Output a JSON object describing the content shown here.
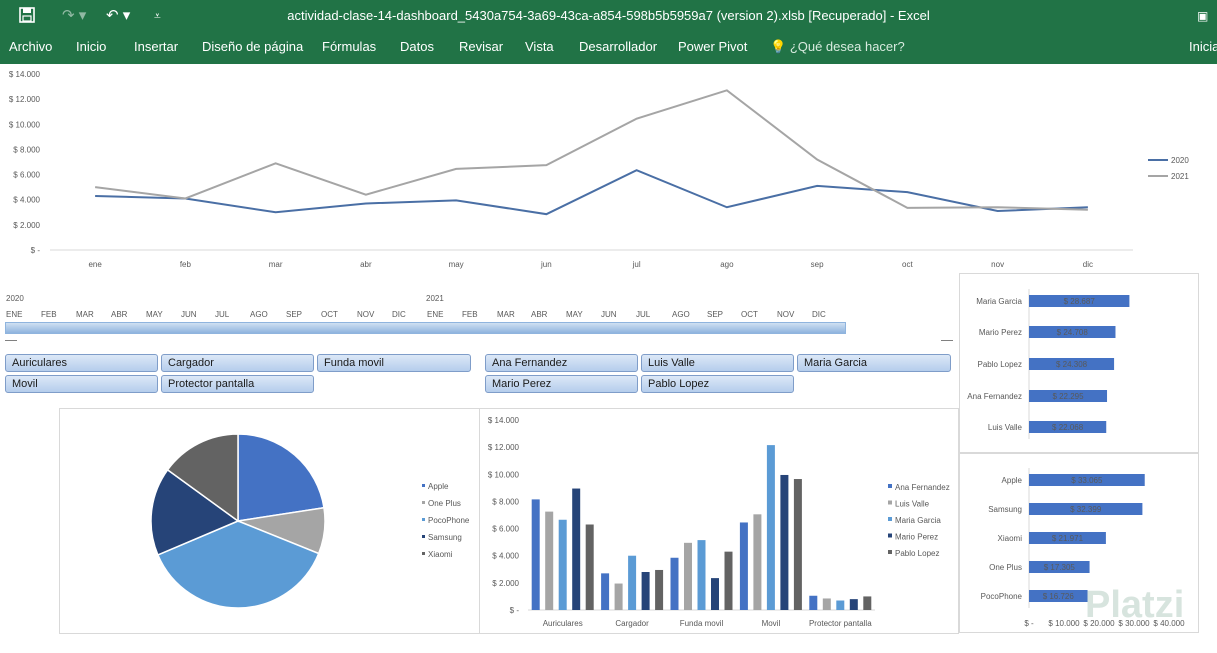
{
  "window": {
    "title": "actividad-clase-14-dashboard_5430a754-3a69-43ca-a854-598b5b5959a7 (version 2).xlsb [Recuperado] - Excel",
    "save_icon": "save-icon",
    "redo_icon": "redo-icon",
    "undo_icon": "undo-icon",
    "customize_icon": "customize-qat-icon",
    "restore_icon": "ribbon-display-icon"
  },
  "ribbon": {
    "tabs": [
      "Archivo",
      "Inicio",
      "Insertar",
      "Diseño de página",
      "Fórmulas",
      "Datos",
      "Revisar",
      "Vista",
      "Desarrollador",
      "Power Pivot"
    ],
    "search_placeholder": "¿Qué desea hacer?",
    "signin": "Inicia"
  },
  "colors": {
    "excel_green": "#217346",
    "series_2020": "#4a6fa5",
    "series_2021": "#a5a5a5",
    "bar_blue": "#4472c4"
  },
  "timeline": {
    "year_2020": "2020",
    "year_2021": "2021",
    "months": [
      "ENE",
      "FEB",
      "MAR",
      "ABR",
      "MAY",
      "JUN",
      "JUL",
      "AGO",
      "SEP",
      "OCT",
      "NOV",
      "DIC",
      "ENE",
      "FEB",
      "MAR",
      "ABR",
      "MAY",
      "JUN",
      "JUL",
      "AGO",
      "SEP",
      "OCT",
      "NOV",
      "DIC"
    ]
  },
  "slicers": {
    "product": [
      "Auriculares",
      "Cargador",
      "Funda movil",
      "Movil",
      "Protector pantalla"
    ],
    "seller": [
      "Ana Fernandez",
      "Luis Valle",
      "Maria Garcia",
      "Mario Perez",
      "Pablo Lopez"
    ]
  },
  "watermark": "Platzi",
  "chart_data": [
    {
      "type": "line",
      "x": [
        "ene",
        "feb",
        "mar",
        "abr",
        "may",
        "jun",
        "jul",
        "ago",
        "sep",
        "oct",
        "nov",
        "dic"
      ],
      "series": [
        {
          "name": "2020",
          "values": [
            4300,
            4100,
            3000,
            3700,
            3950,
            2850,
            6350,
            3400,
            5100,
            4600,
            3100,
            3400
          ]
        },
        {
          "name": "2021",
          "values": [
            5000,
            4100,
            6900,
            4400,
            6450,
            6750,
            10450,
            12700,
            7200,
            3350,
            3400,
            3200
          ]
        }
      ],
      "yticks": [
        "$ -",
        "$ 2.000",
        "$ 4.000",
        "$ 6.000",
        "$ 8.000",
        "$ 10.000",
        "$ 12.000",
        "$ 14.000"
      ],
      "ylim": [
        0,
        14000
      ],
      "legend": "right"
    },
    {
      "type": "pie",
      "categories": [
        "Apple",
        "One Plus",
        "PocoPhone",
        "Samsung",
        "Xiaomi"
      ],
      "values": [
        33065,
        12500,
        55000,
        24000,
        21971
      ],
      "legend": "right"
    },
    {
      "type": "bar",
      "categories": [
        "Auriculares",
        "Cargador",
        "Funda movil",
        "Movil",
        "Protector pantalla"
      ],
      "series": [
        {
          "name": "Ana Fernandez",
          "values": [
            8150,
            2700,
            3850,
            6450,
            1050
          ]
        },
        {
          "name": "Luis Valle",
          "values": [
            7250,
            1950,
            4950,
            7050,
            850
          ]
        },
        {
          "name": "Maria Garcia",
          "values": [
            6650,
            4000,
            5150,
            12150,
            700
          ]
        },
        {
          "name": "Mario Perez",
          "values": [
            8950,
            2800,
            2350,
            9950,
            800
          ]
        },
        {
          "name": "Pablo Lopez",
          "values": [
            6300,
            2950,
            4300,
            9650,
            1000
          ]
        }
      ],
      "yticks": [
        "$ -",
        "$ 2.000",
        "$ 4.000",
        "$ 6.000",
        "$ 8.000",
        "$ 10.000",
        "$ 12.000",
        "$ 14.000"
      ],
      "ylim": [
        0,
        14000
      ],
      "legend": "right"
    },
    {
      "type": "bar",
      "orientation": "horizontal",
      "categories": [
        "Maria Garcia",
        "Mario Perez",
        "Pablo Lopez",
        "Ana Fernandez",
        "Luis Valle"
      ],
      "values": [
        28687,
        24708,
        24308,
        22295,
        22068
      ],
      "labels": [
        "$ 28.687",
        "$ 24.708",
        "$ 24.308",
        "$ 22.295",
        "$ 22.068"
      ],
      "xlim": [
        0,
        40000
      ]
    },
    {
      "type": "bar",
      "orientation": "horizontal",
      "categories": [
        "Apple",
        "Samsung",
        "Xiaomi",
        "One Plus",
        "PocoPhone"
      ],
      "values": [
        33065,
        32399,
        21971,
        17305,
        16726
      ],
      "labels": [
        "$ 33.065",
        "$ 32.399",
        "$ 21.971",
        "$ 17.305",
        "$ 16.726"
      ],
      "xticks": [
        "$ -",
        "$ 10.000",
        "$ 20.000",
        "$ 30.000",
        "$ 40.000"
      ],
      "xlim": [
        0,
        40000
      ]
    }
  ]
}
